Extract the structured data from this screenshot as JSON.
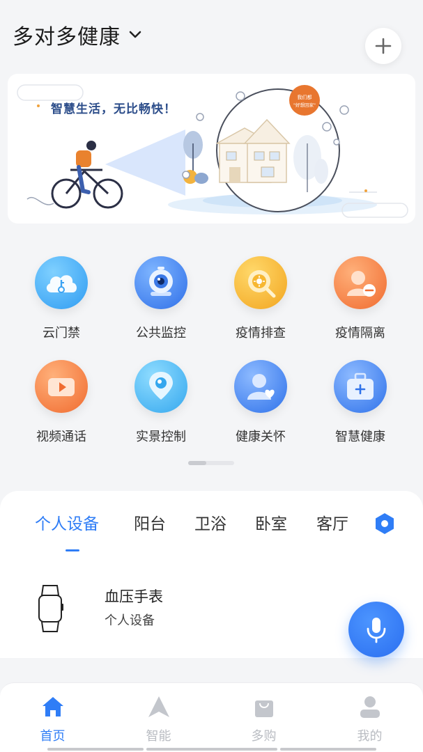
{
  "header": {
    "home_name": "多对多健康",
    "add_icon": "plus-icon",
    "dropdown_icon": "chevron-down-icon"
  },
  "banner": {
    "slogan": "智慧生活，无比畅快！",
    "badge_line1": "我们都",
    "badge_line2": "\"好想回家\""
  },
  "services": [
    {
      "label": "云门禁",
      "icon": "cloud-key-icon",
      "color": "#3aa9f5"
    },
    {
      "label": "公共监控",
      "icon": "camera-icon",
      "color": "#3b7ff0"
    },
    {
      "label": "疫情排查",
      "icon": "search-virus-icon",
      "color": "#f5b32d"
    },
    {
      "label": "疫情隔离",
      "icon": "person-minus-icon",
      "color": "#f4834a"
    },
    {
      "label": "视频通话",
      "icon": "video-call-icon",
      "color": "#f4834a"
    },
    {
      "label": "实景控制",
      "icon": "location-eye-icon",
      "color": "#41b5f2"
    },
    {
      "label": "健康关怀",
      "icon": "person-heart-icon",
      "color": "#3b8bf0"
    },
    {
      "label": "智慧健康",
      "icon": "medical-kit-icon",
      "color": "#3e8ff2"
    }
  ],
  "rooms": {
    "tabs": [
      "个人设备",
      "阳台",
      "卫浴",
      "卧室",
      "客厅"
    ],
    "active_tab": "个人设备",
    "settings_icon": "hexagon-settings-icon"
  },
  "device": {
    "name": "血压手表",
    "room": "个人设备",
    "icon": "watch-icon"
  },
  "voice_button": {
    "icon": "microphone-icon"
  },
  "bottom_nav": [
    {
      "label": "首页",
      "icon": "home-icon",
      "active": true
    },
    {
      "label": "智能",
      "icon": "navigation-arrow-icon",
      "active": false
    },
    {
      "label": "多购",
      "icon": "shopping-bag-icon",
      "active": false
    },
    {
      "label": "我的",
      "icon": "user-icon",
      "active": false
    }
  ],
  "colors": {
    "accent": "#2f7df6",
    "inactive": "#b9bcc2",
    "background": "#f4f5f7"
  }
}
